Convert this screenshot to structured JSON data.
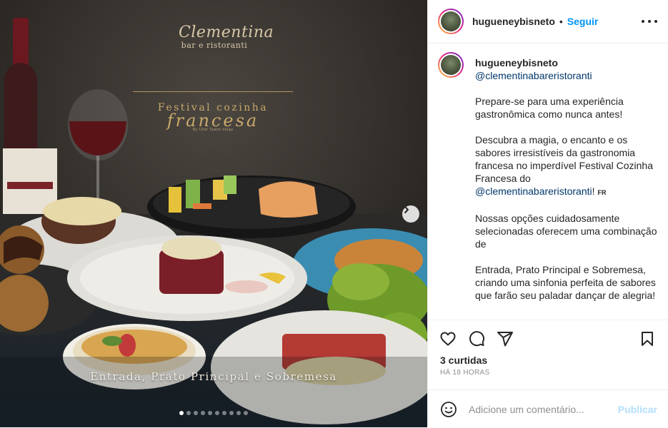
{
  "post_image": {
    "logo_script": "Clementina",
    "logo_sub": "bar e ristoranti",
    "festival_line1": "Festival cozinha",
    "festival_line2": "francesa",
    "festival_credit": "By Chef Tyalor Veiga",
    "caption_text": "Entrada, Prato Principal e Sobremesa",
    "carousel_count": 10,
    "carousel_active": 0
  },
  "header": {
    "username": "hugueneybisneto",
    "separator": "•",
    "follow_label": "Seguir"
  },
  "caption": {
    "username": "hugueneybisneto",
    "mention": "@clementinabareristoranti",
    "paragraph1": "Prepare-se para uma experiência gastronômica como nunca antes!",
    "paragraph2_text": "Descubra a magia, o encanto e os sabores irresistíveis da gastronomia francesa no imperdível Festival Cozinha Francesa do",
    "paragraph2_mention": "@clementinabareristoranti",
    "paragraph2_end": "!",
    "paragraph2_flag": "FR",
    "paragraph3": "Nossas opções cuidadosamente selecionadas oferecem uma combinação de",
    "paragraph4": "Entrada, Prato Principal e Sobremesa, criando uma sinfonia perfeita de sabores que farão seu paladar dançar de alegria!"
  },
  "stats": {
    "likes": "3 curtidas",
    "time": "HÁ 18 HORAS"
  },
  "comment_box": {
    "placeholder": "Adicione um comentário...",
    "post_label": "Publicar"
  },
  "icons": {
    "like": "heart-icon",
    "comment": "comment-icon",
    "share": "share-icon",
    "save": "bookmark-icon",
    "emoji": "emoji-icon",
    "next": "chevron-right-icon",
    "more": "more-options-icon"
  },
  "colors": {
    "accent_blue": "#0095f6",
    "mention_blue": "#00376b",
    "muted": "#8e8e8e",
    "post_disabled": "#b2dffc"
  }
}
